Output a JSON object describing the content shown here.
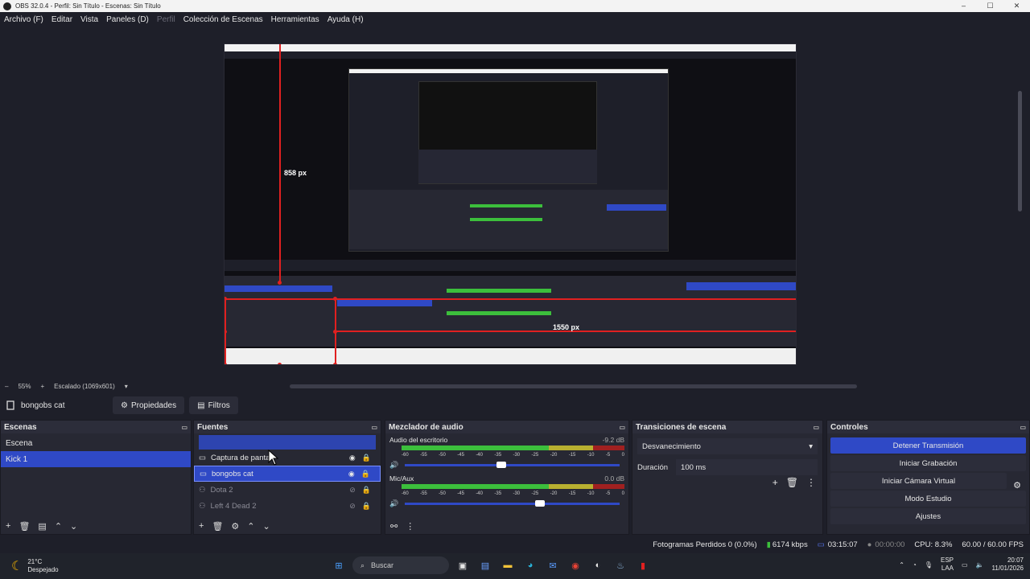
{
  "window": {
    "title": "OBS 32.0.4 - Perfil: Sin Título - Escenas: Sin Título",
    "minimize": "–",
    "maximize": "☐",
    "close": "✕"
  },
  "menu": [
    {
      "label": "Archivo (F)"
    },
    {
      "label": "Editar"
    },
    {
      "label": "Vista"
    },
    {
      "label": "Paneles (D)"
    },
    {
      "label": "Perfil",
      "disabled": true
    },
    {
      "label": "Colección de Escenas"
    },
    {
      "label": "Herramientas"
    },
    {
      "label": "Ayuda (H)"
    }
  ],
  "preview": {
    "measure_v": "858 px",
    "measure_h": "1550 px"
  },
  "zoom": {
    "minus": "–",
    "value": "55%",
    "plus": "+",
    "scale": "Escalado (1069x601)",
    "dropdown": "▾"
  },
  "source_bar": {
    "selected": "bongobs cat",
    "properties": "Propiedades",
    "filters": "Filtros"
  },
  "scenes": {
    "title": "Escenas",
    "items": [
      {
        "label": "Escena",
        "selected": false
      },
      {
        "label": "Kick 1",
        "selected": true
      }
    ]
  },
  "sources": {
    "title": "Fuentes",
    "items": [
      {
        "label": "Captura de pantalla",
        "selected": false,
        "dim": false
      },
      {
        "label": "bongobs cat",
        "selected": true,
        "dim": false
      },
      {
        "label": "Dota 2",
        "selected": false,
        "dim": true
      },
      {
        "label": "Left 4 Dead 2",
        "selected": false,
        "dim": true
      }
    ]
  },
  "mixer": {
    "title": "Mezclador de audio",
    "channels": [
      {
        "name": "Audio del escritorio",
        "db": "-9.2 dB",
        "level": 0.45
      },
      {
        "name": "Mic/Aux",
        "db": "0.0 dB",
        "level": 0.63
      }
    ],
    "ticks": [
      "-60",
      "-55",
      "-50",
      "-45",
      "-40",
      "-35",
      "-30",
      "-25",
      "-20",
      "-15",
      "-10",
      "-5",
      "0"
    ]
  },
  "transitions": {
    "title": "Transiciones de escena",
    "selected": "Desvanecimiento",
    "duration_label": "Duración",
    "duration_value": "100 ms"
  },
  "controls": {
    "title": "Controles",
    "buttons": [
      {
        "label": "Detener Transmisión",
        "active": true
      },
      {
        "label": "Iniciar Grabación",
        "active": false
      },
      {
        "label": "Iniciar Cámara Virtual",
        "active": false
      },
      {
        "label": "Modo Estudio",
        "active": false
      },
      {
        "label": "Ajustes",
        "active": false
      }
    ]
  },
  "status": {
    "dropped": "Fotogramas Perdidos 0 (0.0%)",
    "bitrate": "6174 kbps",
    "stream_time": "03:15:07",
    "rec_time": "00:00:00",
    "cpu": "CPU: 8.3%",
    "fps": "60.00 / 60.00 FPS"
  },
  "taskbar": {
    "temp": "21°C",
    "weather": "Despejado",
    "search": "Buscar",
    "lang1": "ESP",
    "lang2": "LAA",
    "time": "20:07",
    "date": "11/01/2026"
  },
  "colors": {
    "accent": "#2f49c6",
    "selection_red": "#e02020",
    "panel": "#272833",
    "bg": "#1e1f29"
  }
}
